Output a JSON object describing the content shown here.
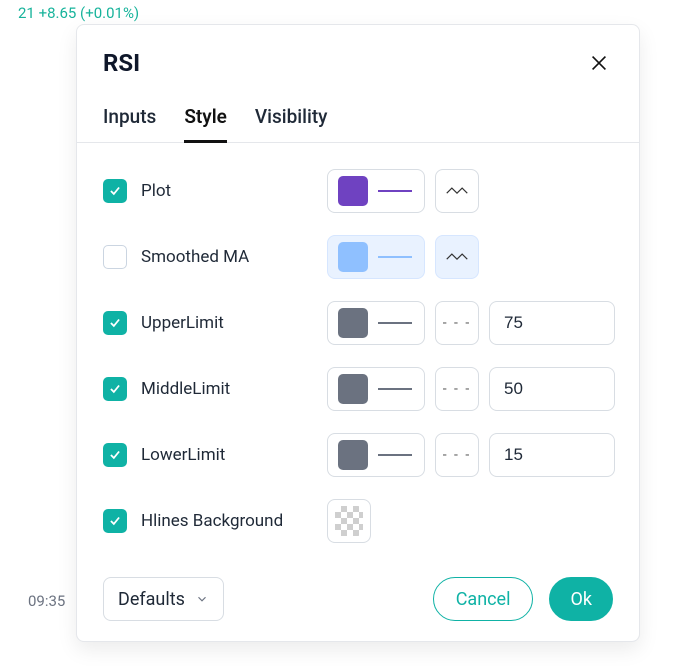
{
  "background": {
    "price_delta": "21 +8.65 (+0.01%)",
    "time_label": "09:35"
  },
  "modal": {
    "title": "RSI",
    "tabs": {
      "inputs": "Inputs",
      "style": "Style",
      "visibility": "Visibility",
      "active": "style"
    },
    "rows": {
      "plot": {
        "label": "Plot",
        "checked": true,
        "color": "#6f42c1",
        "disabled": false
      },
      "smoothed": {
        "label": "Smoothed MA",
        "checked": false,
        "color": "#8fc0ff",
        "disabled": true
      },
      "upper": {
        "label": "UpperLimit",
        "checked": true,
        "color": "#6b7280",
        "value": "75"
      },
      "middle": {
        "label": "MiddleLimit",
        "checked": true,
        "color": "#6b7280",
        "value": "50"
      },
      "lower": {
        "label": "LowerLimit",
        "checked": true,
        "color": "#6b7280",
        "value": "15"
      },
      "hlines": {
        "label": "Hlines Background",
        "checked": true
      }
    },
    "footer": {
      "defaults": "Defaults",
      "cancel": "Cancel",
      "ok": "Ok"
    }
  }
}
